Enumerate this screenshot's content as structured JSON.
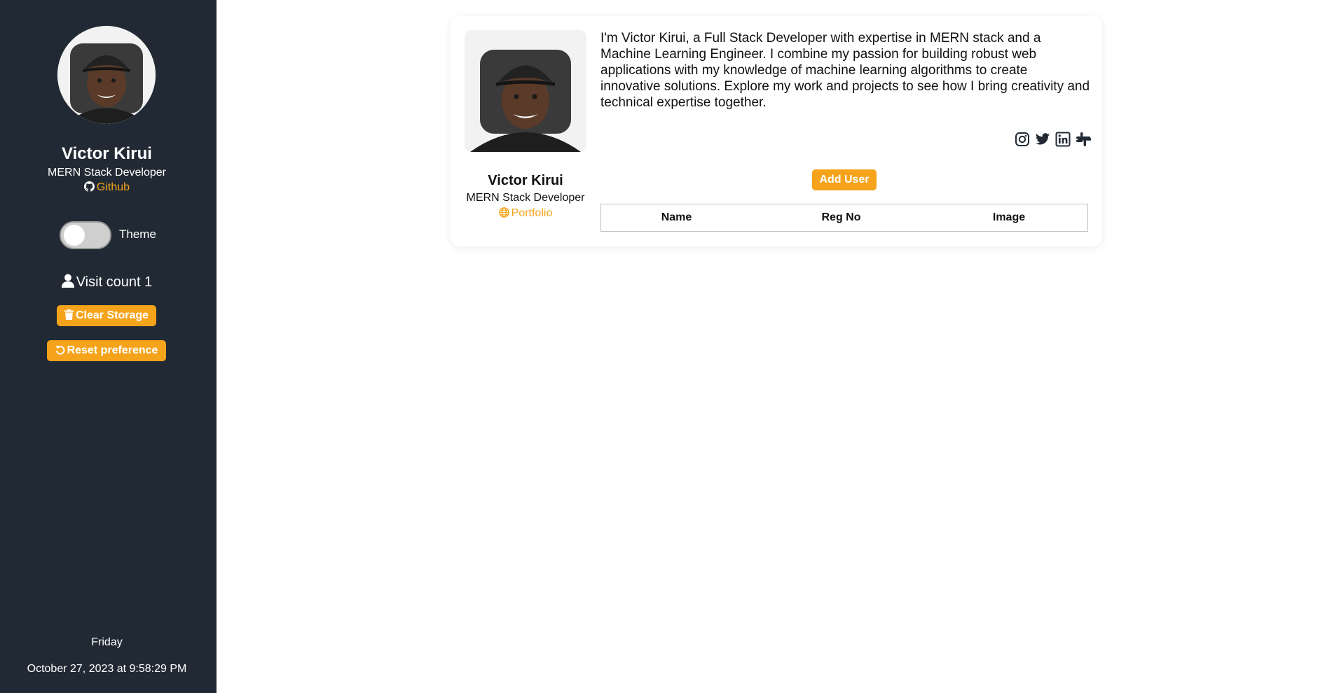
{
  "sidebar": {
    "name": "Victor Kirui",
    "role": "MERN Stack Developer",
    "github_label": "Github",
    "theme_label": "Theme",
    "theme_toggle_on": false,
    "visit_text": "Visit count 1",
    "clear_storage_label": "Clear Storage",
    "reset_preference_label": "Reset preference",
    "day": "Friday",
    "datetime": "October 27, 2023 at 9:58:29 PM"
  },
  "card": {
    "bio": "I'm Victor Kirui, a Full Stack Developer with expertise in MERN stack and a Machine Learning Engineer. I combine my passion for building robust web applications with my knowledge of machine learning algorithms to create innovative solutions. Explore my work and projects to see how I bring creativity and technical expertise together.",
    "name": "Victor Kirui",
    "role": "MERN Stack Developer",
    "portfolio_label": "Portfolio",
    "socials": [
      "instagram-icon",
      "twitter-icon",
      "linkedin-icon",
      "slack-icon"
    ],
    "add_user_label": "Add User",
    "table": {
      "columns": [
        "Name",
        "Reg No",
        "Image"
      ],
      "rows": []
    }
  },
  "colors": {
    "sidebar_bg": "#212a34",
    "accent": "#f5a31a",
    "text": "#111111"
  }
}
